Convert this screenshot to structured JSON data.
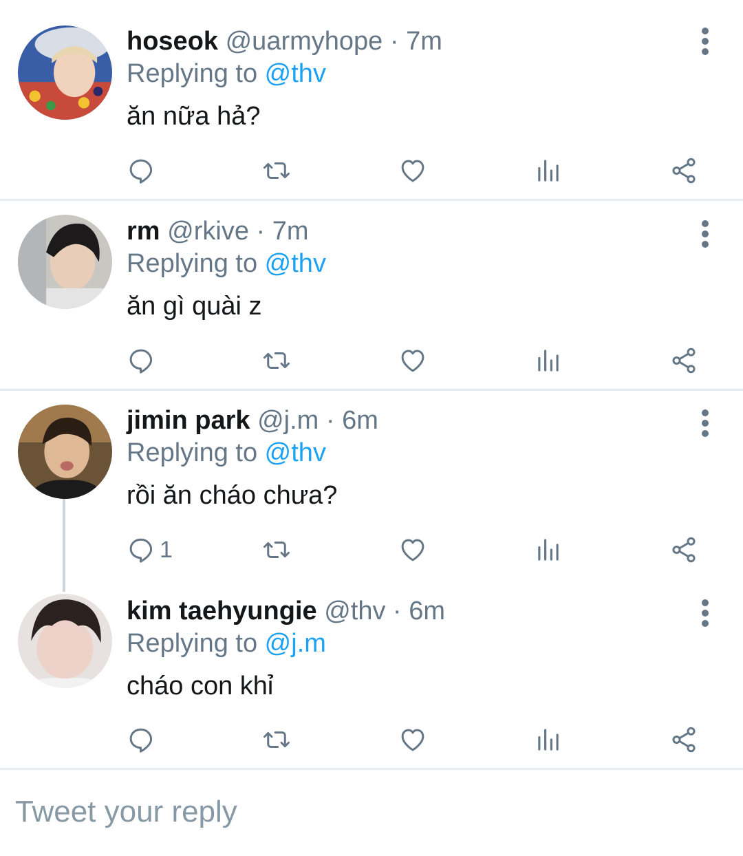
{
  "replies": [
    {
      "name": "hoseok",
      "handle": "@uarmyhope",
      "time": "7m",
      "replying_prefix": "Replying to ",
      "replying_to": "@thv",
      "text": "ăn nữa hả?",
      "reply_count": ""
    },
    {
      "name": "rm",
      "handle": "@rkive",
      "time": "7m",
      "replying_prefix": "Replying to ",
      "replying_to": "@thv",
      "text": "ăn gì quài z",
      "reply_count": ""
    },
    {
      "name": "jimin park",
      "handle": "@j.m",
      "time": "6m",
      "replying_prefix": "Replying to ",
      "replying_to": "@thv",
      "text": "rồi ăn cháo chưa?",
      "reply_count": "1"
    },
    {
      "name": "kim taehyungie",
      "handle": "@thv",
      "time": "6m",
      "replying_prefix": "Replying to ",
      "replying_to": "@j.m",
      "text": "cháo con khỉ",
      "reply_count": ""
    }
  ],
  "separator": " · ",
  "composer": {
    "placeholder": "Tweet your reply"
  },
  "colors": {
    "accent": "#1da1f2",
    "secondary_text": "#657786",
    "divider": "#e6ecf0"
  },
  "icons": [
    "reply-icon",
    "retweet-icon",
    "like-icon",
    "analytics-icon",
    "share-icon",
    "more-icon"
  ]
}
